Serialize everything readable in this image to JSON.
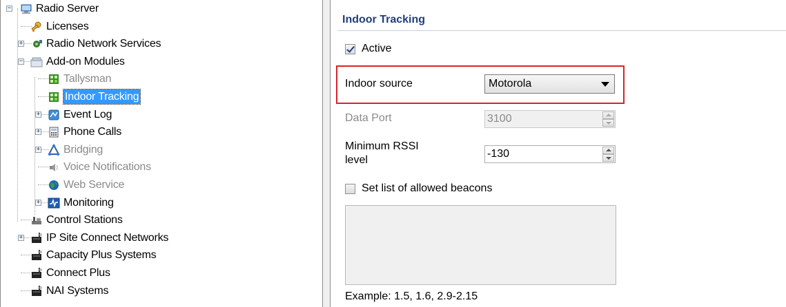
{
  "tree": {
    "items": [
      {
        "label": "Radio Server",
        "icon": "server-icon",
        "expander": "minus",
        "disabled": false,
        "selected": false
      },
      {
        "label": "Licenses",
        "icon": "licenses-icon",
        "expander": null,
        "disabled": false,
        "selected": false
      },
      {
        "label": "Radio Network Services",
        "icon": "network-services-icon",
        "expander": "plus",
        "disabled": false,
        "selected": false
      },
      {
        "label": "Add-on Modules",
        "icon": "addon-modules-icon",
        "expander": "minus",
        "disabled": false,
        "selected": false
      },
      {
        "label": "Tallysman",
        "icon": "module-icon",
        "expander": null,
        "disabled": true,
        "selected": false
      },
      {
        "label": "Indoor Tracking",
        "icon": "module-icon",
        "expander": null,
        "disabled": false,
        "selected": true
      },
      {
        "label": "Event Log",
        "icon": "event-log-icon",
        "expander": "plus",
        "disabled": false,
        "selected": false
      },
      {
        "label": "Phone Calls",
        "icon": "phone-calls-icon",
        "expander": "plus",
        "disabled": false,
        "selected": false
      },
      {
        "label": "Bridging",
        "icon": "bridging-icon",
        "expander": "plus",
        "disabled": true,
        "selected": false
      },
      {
        "label": "Voice Notifications",
        "icon": "voice-notifications-icon",
        "expander": null,
        "disabled": true,
        "selected": false
      },
      {
        "label": "Web Service",
        "icon": "web-service-icon",
        "expander": null,
        "disabled": true,
        "selected": false
      },
      {
        "label": "Monitoring",
        "icon": "monitoring-icon",
        "expander": "plus",
        "disabled": false,
        "selected": false
      },
      {
        "label": "Control Stations",
        "icon": "control-stations-icon",
        "expander": null,
        "disabled": false,
        "selected": false
      },
      {
        "label": "IP Site Connect Networks",
        "icon": "repeater-icon",
        "expander": "plus",
        "disabled": false,
        "selected": false
      },
      {
        "label": "Capacity Plus Systems",
        "icon": "repeater-icon",
        "expander": null,
        "disabled": false,
        "selected": false
      },
      {
        "label": "Connect Plus",
        "icon": "repeater-icon",
        "expander": null,
        "disabled": false,
        "selected": false
      },
      {
        "label": "NAI Systems",
        "icon": "repeater-icon",
        "expander": null,
        "disabled": false,
        "selected": false
      }
    ]
  },
  "panel": {
    "title": "Indoor Tracking",
    "active_label": "Active",
    "active_checked": true,
    "indoor_source_label": "Indoor source",
    "indoor_source_value": "Motorola",
    "data_port_label": "Data Port",
    "data_port_value": "3100",
    "rssi_label_line1": "Minimum RSSI",
    "rssi_label_line2": "level",
    "rssi_value": "-130",
    "beacons_label": "Set list of allowed beacons",
    "beacons_checked": false,
    "example_text": "Example: 1.5, 1.6, 2.9-2.15"
  },
  "colors": {
    "selection": "#3399ff",
    "title": "#1f3f7a",
    "highlight_border": "#d9232a",
    "disabled_text": "#8a8a8a"
  }
}
